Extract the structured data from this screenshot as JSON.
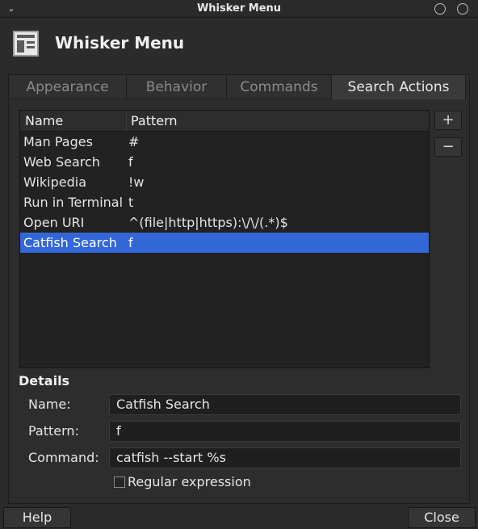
{
  "window": {
    "title": "Whisker Menu",
    "menu_glyph": "⌄"
  },
  "header": {
    "heading": "Whisker Menu"
  },
  "tabs": [
    {
      "label": "Appearance"
    },
    {
      "label": "Behavior"
    },
    {
      "label": "Commands"
    },
    {
      "label": "Search Actions"
    }
  ],
  "list": {
    "columns": {
      "name": "Name",
      "pattern": "Pattern"
    },
    "rows": [
      {
        "name": "Man Pages",
        "pattern": "#"
      },
      {
        "name": "Web Search",
        "pattern": "f"
      },
      {
        "name": "Wikipedia",
        "pattern": "!w"
      },
      {
        "name": "Run in Terminal",
        "pattern": "t"
      },
      {
        "name": "Open URI",
        "pattern": "^(file|http|https):\\/\\/(.*)$"
      },
      {
        "name": "Catfish Search",
        "pattern": "f"
      }
    ]
  },
  "side_buttons": {
    "add": "+",
    "remove": "−"
  },
  "details": {
    "title": "Details",
    "name_label": "Name:",
    "name_value": "Catfish Search",
    "pattern_label": "Pattern:",
    "pattern_value": "f",
    "command_label": "Command:",
    "command_value": "catfish --start %s",
    "regex_label": "Regular expression"
  },
  "buttons": {
    "help": "Help",
    "close": "Close"
  },
  "colors": {
    "selection": "#3367d6",
    "background": "#2b2b2b"
  }
}
